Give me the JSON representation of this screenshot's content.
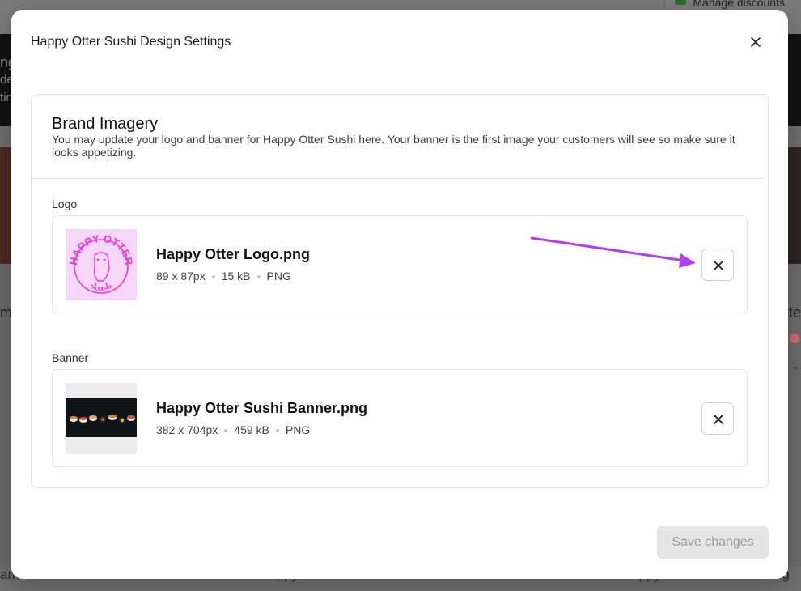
{
  "background": {
    "manage_discounts": "Manage discounts",
    "hero_lines": [
      "ng",
      "de",
      "tin"
    ],
    "left_text": "m",
    "right_text": "tte",
    "bottom_texts": [
      "am",
      "Happy Otter Sushi",
      "Happy Otter Sushi Catering"
    ]
  },
  "modal": {
    "title": "Happy Otter Sushi Design Settings",
    "close_icon": "close-icon",
    "section": {
      "title": "Brand Imagery",
      "description": "You may update your logo and banner for Happy Otter Sushi here. Your banner is the first image your customers will see so make sure it looks appetizing."
    },
    "logo": {
      "label": "Logo",
      "filename": "Happy Otter Logo.png",
      "dimensions": "89 x 87px",
      "size": "15 kB",
      "format": "PNG",
      "logo_text_top": "HAPPY OTTER",
      "logo_text_bottom": "TAQUERIA"
    },
    "banner": {
      "label": "Banner",
      "filename": "Happy Otter Sushi Banner.png",
      "dimensions": "382 x 704px",
      "size": "459 kB",
      "format": "PNG"
    },
    "save_label": "Save changes"
  },
  "colors": {
    "annotation_arrow": "#b23ff0",
    "logo_pink": "#e83ad8",
    "logo_bg": "#f6d7f7",
    "save_disabled_bg": "#e5e5e5",
    "save_disabled_text": "#9b9b9b"
  }
}
